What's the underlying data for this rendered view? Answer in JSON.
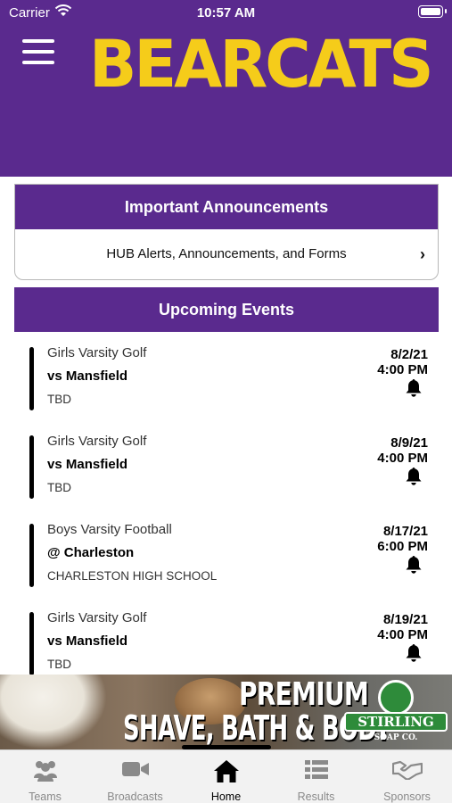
{
  "status_bar": {
    "carrier": "Carrier",
    "time": "10:57 AM"
  },
  "header": {
    "title": "BEARCATS",
    "menu_icon": "hamburger-menu-icon"
  },
  "colors": {
    "brand_purple": "#5a2a8e",
    "brand_gold": "#f5cc1a"
  },
  "announcements": {
    "heading": "Important Announcements",
    "link_label": "HUB Alerts, Announcements, and Forms"
  },
  "events": {
    "heading": "Upcoming Events",
    "items": [
      {
        "sport": "Girls Varsity Golf",
        "opponent": "vs Mansfield",
        "location": "TBD",
        "date": "8/2/21",
        "time": "4:00 PM"
      },
      {
        "sport": "Girls Varsity Golf",
        "opponent": "vs Mansfield",
        "location": "TBD",
        "date": "8/9/21",
        "time": "4:00 PM"
      },
      {
        "sport": "Boys Varsity Football",
        "opponent": "@ Charleston",
        "location": "CHARLESTON HIGH SCHOOL",
        "date": "8/17/21",
        "time": "6:00 PM"
      },
      {
        "sport": "Girls Varsity Golf",
        "opponent": "vs Mansfield",
        "location": "TBD",
        "date": "8/19/21",
        "time": "4:00 PM"
      }
    ]
  },
  "ad": {
    "line1": "PREMIUM",
    "line2": "SHAVE, BATH & BODY",
    "logo_name": "STIRLING",
    "logo_sub": "SOAP CO."
  },
  "tabs": [
    {
      "label": "Teams",
      "icon": "teams-icon"
    },
    {
      "label": "Broadcasts",
      "icon": "video-camera-icon"
    },
    {
      "label": "Home",
      "icon": "home-icon",
      "active": true
    },
    {
      "label": "Results",
      "icon": "list-icon"
    },
    {
      "label": "Sponsors",
      "icon": "handshake-icon"
    }
  ]
}
